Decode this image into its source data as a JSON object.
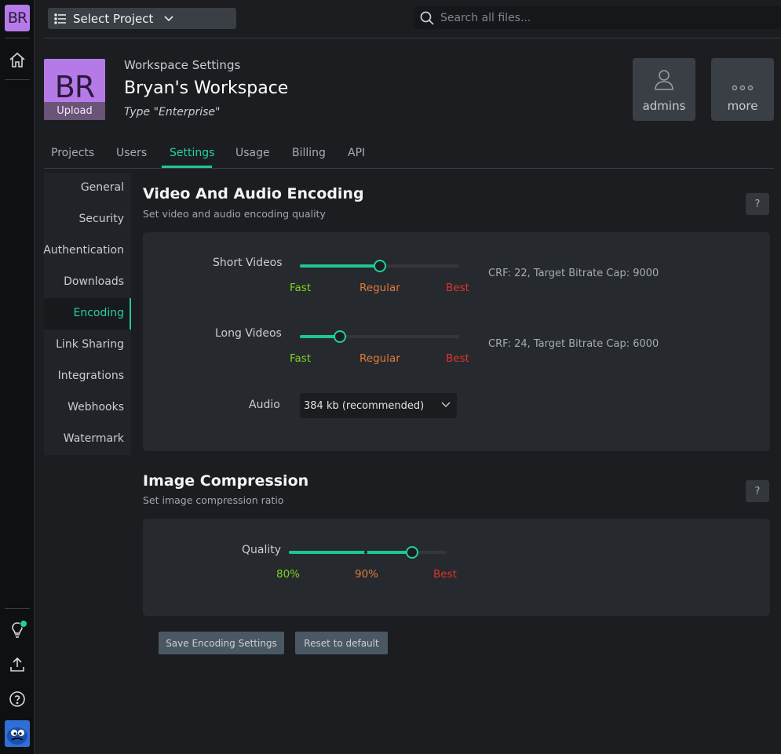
{
  "colors": {
    "accent": "#1dc795",
    "fast": "#7ed321",
    "regular": "#e07b3c",
    "best": "#e0342c",
    "avatar": "#b67ae8"
  },
  "rail": {
    "avatar_initials": "BR",
    "icons": [
      "home-icon",
      "lightbulb-icon",
      "upload-icon",
      "help-icon"
    ]
  },
  "topbar": {
    "project_label": "Select Project",
    "search_placeholder": "Search all files..."
  },
  "workspace": {
    "initials": "BR",
    "upload_label": "Upload",
    "kicker": "Workspace Settings",
    "name": "Bryan's Workspace",
    "type": "Type \"Enterprise\"",
    "buttons": [
      {
        "label": "admins",
        "icon": "user-icon"
      },
      {
        "label": "more",
        "icon": "more-icon"
      }
    ]
  },
  "tabs": [
    {
      "label": "Projects",
      "active": false
    },
    {
      "label": "Users",
      "active": false
    },
    {
      "label": "Settings",
      "active": true
    },
    {
      "label": "Usage",
      "active": false
    },
    {
      "label": "Billing",
      "active": false
    },
    {
      "label": "API",
      "active": false
    }
  ],
  "sidenav": [
    {
      "label": "General"
    },
    {
      "label": "Security"
    },
    {
      "label": "Authentication"
    },
    {
      "label": "Downloads"
    },
    {
      "label": "Encoding",
      "active": true
    },
    {
      "label": "Link Sharing"
    },
    {
      "label": "Integrations"
    },
    {
      "label": "Webhooks"
    },
    {
      "label": "Watermark"
    }
  ],
  "encoding": {
    "title": "Video And Audio Encoding",
    "subtitle": "Set video and audio encoding quality",
    "help": "?",
    "short_videos": {
      "label": "Short Videos",
      "value_fraction": 0.5,
      "scale": [
        "Fast",
        "Regular",
        "Best"
      ],
      "info": "CRF: 22, Target Bitrate Cap: 9000"
    },
    "long_videos": {
      "label": "Long Videos",
      "value_fraction": 0.25,
      "scale": [
        "Fast",
        "Regular",
        "Best"
      ],
      "info": "CRF: 24, Target Bitrate Cap: 6000"
    },
    "audio": {
      "label": "Audio",
      "selected": "384 kb (recommended)"
    }
  },
  "image_compression": {
    "title": "Image Compression",
    "subtitle": "Set image compression ratio",
    "help": "?",
    "quality": {
      "label": "Quality",
      "value_fraction": 0.78,
      "scale": [
        "80%",
        "90%",
        "Best"
      ]
    }
  },
  "actions": {
    "save": "Save Encoding Settings",
    "reset": "Reset to default"
  }
}
